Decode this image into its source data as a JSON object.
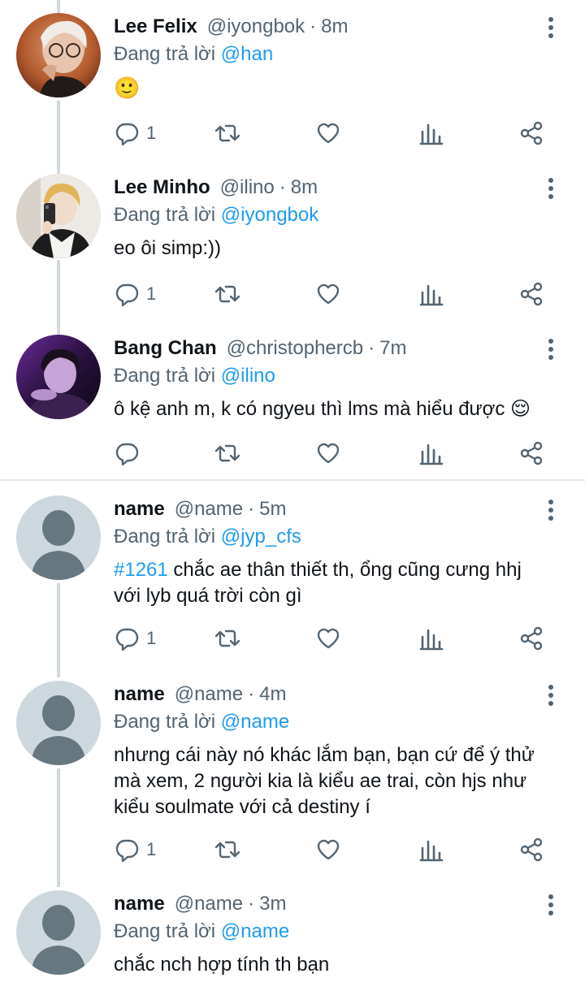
{
  "replying_prefix": "Đang trả lời",
  "colors": {
    "accent": "#1d9bf0",
    "muted": "#536471",
    "line": "#cfd9de",
    "default_avatar_bg": "#cdd8de",
    "default_avatar_fg": "#66777f"
  },
  "tweets": [
    {
      "name": "Lee Felix",
      "handle": "@iyongbok",
      "separator": "·",
      "time": "8m",
      "reply_to": "@han",
      "text": "🙂",
      "reply_count": "1",
      "avatar": "photo"
    },
    {
      "name": "Lee Minho",
      "handle": "@ilino",
      "separator": "·",
      "time": "8m",
      "reply_to": "@iyongbok",
      "text": "eo ôi simp:))",
      "reply_count": "1",
      "avatar": "photo"
    },
    {
      "name": "Bang Chan",
      "handle": "@christophercb",
      "separator": "·",
      "time": "7m",
      "reply_to": "@ilino",
      "text": "ô kệ anh m, k có ngyeu thì lms mà hiểu được 😌",
      "reply_count": "",
      "avatar": "photo"
    },
    {
      "name": "name",
      "handle": "@name",
      "separator": "·",
      "time": "5m",
      "reply_to": "@jyp_cfs",
      "hashtag": "#1261",
      "text_line1": " chắc ae thân thiết th, ổng cũng cưng hhj",
      "text_line2": "với lyb quá trời còn gì",
      "reply_count": "1",
      "avatar": "default"
    },
    {
      "name": "name",
      "handle": "@name",
      "separator": "·",
      "time": "4m",
      "reply_to": "@name",
      "text_line1": "nhưng cái này nó khác lắm bạn, bạn cứ để ý thử",
      "text_line2": "mà xem, 2 người kia là kiểu ae trai, còn hjs như",
      "text_line3": "kiểu soulmate với cả destiny í",
      "reply_count": "1",
      "avatar": "default"
    },
    {
      "name": "name",
      "handle": "@name",
      "separator": "·",
      "time": "3m",
      "reply_to": "@name",
      "text": "chắc nch hợp tính th bạn",
      "avatar": "default"
    }
  ]
}
